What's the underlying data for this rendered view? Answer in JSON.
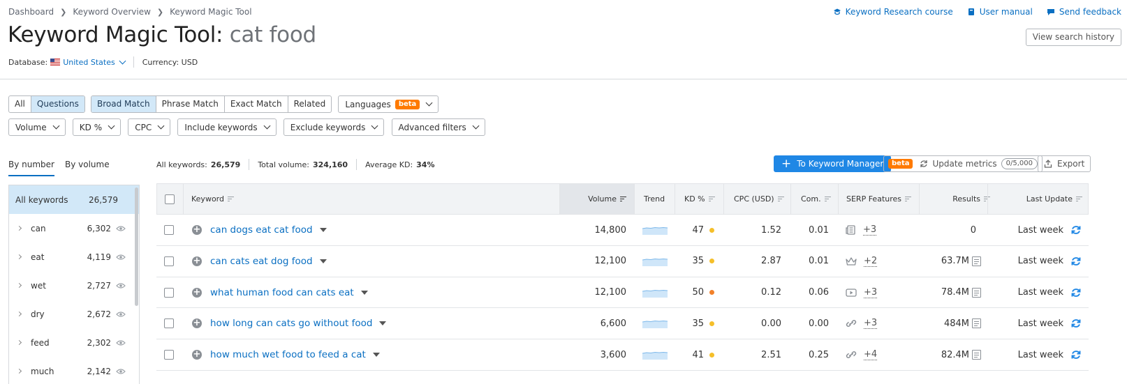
{
  "breadcrumb": [
    "Dashboard",
    "Keyword Overview",
    "Keyword Magic Tool"
  ],
  "header": {
    "title": "Keyword Magic Tool:",
    "query": "cat food",
    "database_label": "Database:",
    "database_value": "United States",
    "currency": "Currency: USD"
  },
  "toplinks": {
    "course": "Keyword Research course",
    "manual": "User manual",
    "feedback": "Send feedback",
    "history": "View search history"
  },
  "filters": {
    "type_tabs": [
      "All",
      "Questions"
    ],
    "match_tabs": [
      "Broad Match",
      "Phrase Match",
      "Exact Match",
      "Related"
    ],
    "languages": "Languages",
    "beta": "beta",
    "dropdowns": [
      "Volume",
      "KD %",
      "CPC",
      "Include keywords",
      "Exclude keywords",
      "Advanced filters"
    ]
  },
  "side": {
    "tabs": [
      "By number",
      "By volume"
    ],
    "all_label": "All keywords",
    "all_count": "26,579",
    "items": [
      {
        "word": "can",
        "count": "6,302"
      },
      {
        "word": "eat",
        "count": "4,119"
      },
      {
        "word": "wet",
        "count": "2,727"
      },
      {
        "word": "dry",
        "count": "2,672"
      },
      {
        "word": "feed",
        "count": "2,302"
      },
      {
        "word": "much",
        "count": "2,142"
      }
    ]
  },
  "stats": {
    "all_label": "All keywords:",
    "all_value": "26,579",
    "vol_label": "Total volume:",
    "vol_value": "324,160",
    "kd_label": "Average KD:",
    "kd_value": "34%"
  },
  "actions": {
    "manager": "To Keyword Manager",
    "beta": "beta",
    "update": "Update metrics",
    "quota": "0/5,000",
    "export": "Export"
  },
  "table": {
    "headers": {
      "keyword": "Keyword",
      "volume": "Volume",
      "trend": "Trend",
      "kd": "KD %",
      "cpc": "CPC (USD)",
      "com": "Com.",
      "serp": "SERP Features",
      "results": "Results",
      "update": "Last Update"
    },
    "rows": [
      {
        "keyword": "can dogs eat cat food",
        "volume": "14,800",
        "kd": "47",
        "kd_color": "#f5bf2a",
        "cpc": "1.52",
        "com": "0.01",
        "serp_icon": "newspaper-icon",
        "serp_more": "+3",
        "results": "0",
        "results_doc": false,
        "update": "Last week"
      },
      {
        "keyword": "can cats eat dog food",
        "volume": "12,100",
        "kd": "35",
        "kd_color": "#f5bf2a",
        "cpc": "2.87",
        "com": "0.01",
        "serp_icon": "crown-icon",
        "serp_more": "+2",
        "results": "63.7M",
        "results_doc": true,
        "update": "Last week"
      },
      {
        "keyword": "what human food can cats eat",
        "volume": "12,100",
        "kd": "50",
        "kd_color": "#f2812a",
        "cpc": "0.12",
        "com": "0.06",
        "serp_icon": "video-icon",
        "serp_more": "+3",
        "results": "78.4M",
        "results_doc": true,
        "update": "Last week"
      },
      {
        "keyword": "how long can cats go without food",
        "volume": "6,600",
        "kd": "35",
        "kd_color": "#f5bf2a",
        "cpc": "0.00",
        "com": "0.00",
        "serp_icon": "link-icon",
        "serp_more": "+3",
        "results": "484M",
        "results_doc": true,
        "update": "Last week"
      },
      {
        "keyword": "how much wet food to feed a cat",
        "volume": "3,600",
        "kd": "41",
        "kd_color": "#f5bf2a",
        "cpc": "2.51",
        "com": "0.25",
        "serp_icon": "link-icon",
        "serp_more": "+4",
        "results": "82.4M",
        "results_doc": true,
        "update": "Last week"
      }
    ]
  }
}
